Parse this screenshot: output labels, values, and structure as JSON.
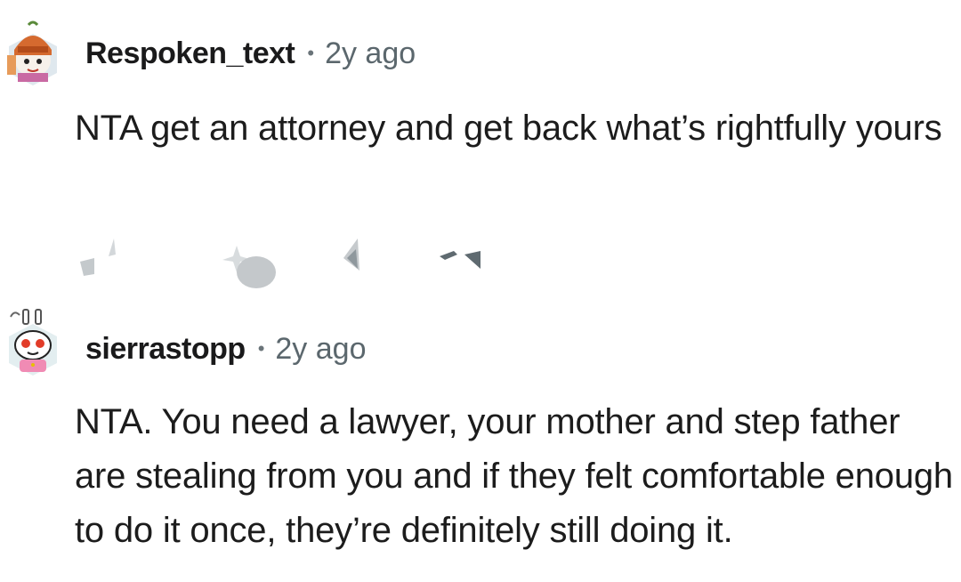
{
  "comments": [
    {
      "username": "Respoken_text",
      "separator": "•",
      "time": "2y ago",
      "text": "NTA get an attorney and get back what’s rightfully yours"
    },
    {
      "username": "sierrastopp",
      "separator": "•",
      "time": "2y ago",
      "text": "NTA. You need a lawyer, your mother and step father are stealing from you and if they felt comfortable enough to do it once, they’re definitely still doing it."
    }
  ],
  "colors": {
    "username": "#1a1a1b",
    "meta": "#5b676d",
    "body": "#1c1c1c",
    "action_icon": "#b8bdc0",
    "action_icon_dark": "#5f6a70"
  },
  "icons": {
    "avatar_1": "snoo-avatar-cat-hat",
    "avatar_2": "snoo-avatar-bunny-ears",
    "upvote": "upvote-icon",
    "reply": "reply-bubble-icon",
    "share": "share-icon",
    "more": "more-options-icon"
  }
}
